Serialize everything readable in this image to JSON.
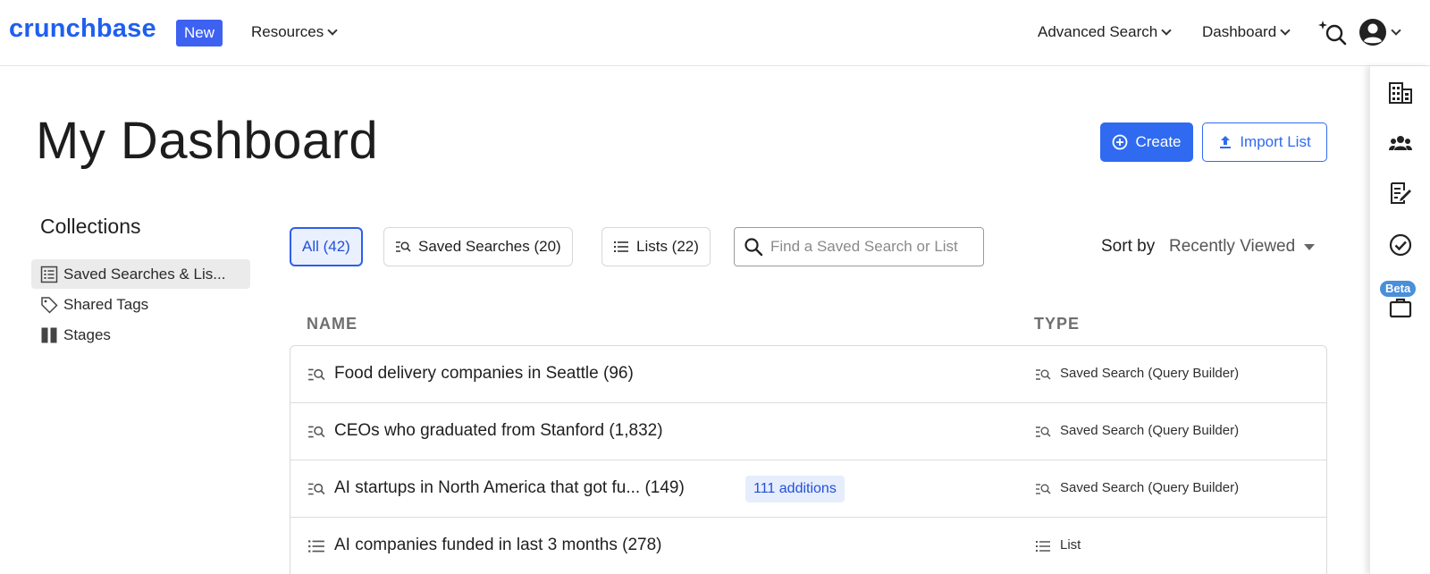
{
  "topnav": {
    "logo": "crunchbase",
    "new_badge": "New",
    "resources": "Resources",
    "advanced_search": "Advanced Search",
    "dashboard": "Dashboard"
  },
  "page": {
    "title": "My Dashboard",
    "create_label": "Create",
    "import_label": "Import List"
  },
  "collections": {
    "title": "Collections",
    "items": [
      {
        "label": "Saved Searches & Lis..."
      },
      {
        "label": "Shared Tags"
      },
      {
        "label": "Stages"
      }
    ]
  },
  "filters": {
    "all": "All (42)",
    "saved_searches": "Saved Searches (20)",
    "lists": "Lists (22)",
    "search_placeholder": "Find a Saved Search or List"
  },
  "sort": {
    "label": "Sort by",
    "value": "Recently Viewed"
  },
  "table": {
    "headers": [
      "NAME",
      "TYPE"
    ],
    "rows": [
      {
        "name": "Food delivery companies in Seattle",
        "count": "(96)",
        "badge": "",
        "type": "Saved Search (Query Builder)",
        "icon": "saved-search-icon"
      },
      {
        "name": "CEOs who graduated from Stanford",
        "count": "(1,832)",
        "badge": "",
        "type": "Saved Search (Query Builder)",
        "icon": "saved-search-icon"
      },
      {
        "name": "AI startups in North America that got fu...",
        "count": "(149)",
        "badge": "111 additions",
        "type": "Saved Search (Query Builder)",
        "icon": "saved-search-icon"
      },
      {
        "name": "AI companies funded in last 3 months",
        "count": "(278)",
        "badge": "",
        "type": "List",
        "icon": "list-icon"
      }
    ]
  },
  "rail": {
    "beta": "Beta"
  },
  "colors": {
    "brand": "#1f5ff0",
    "primary": "#2f6af0",
    "badge_bg": "#e6edfd"
  }
}
